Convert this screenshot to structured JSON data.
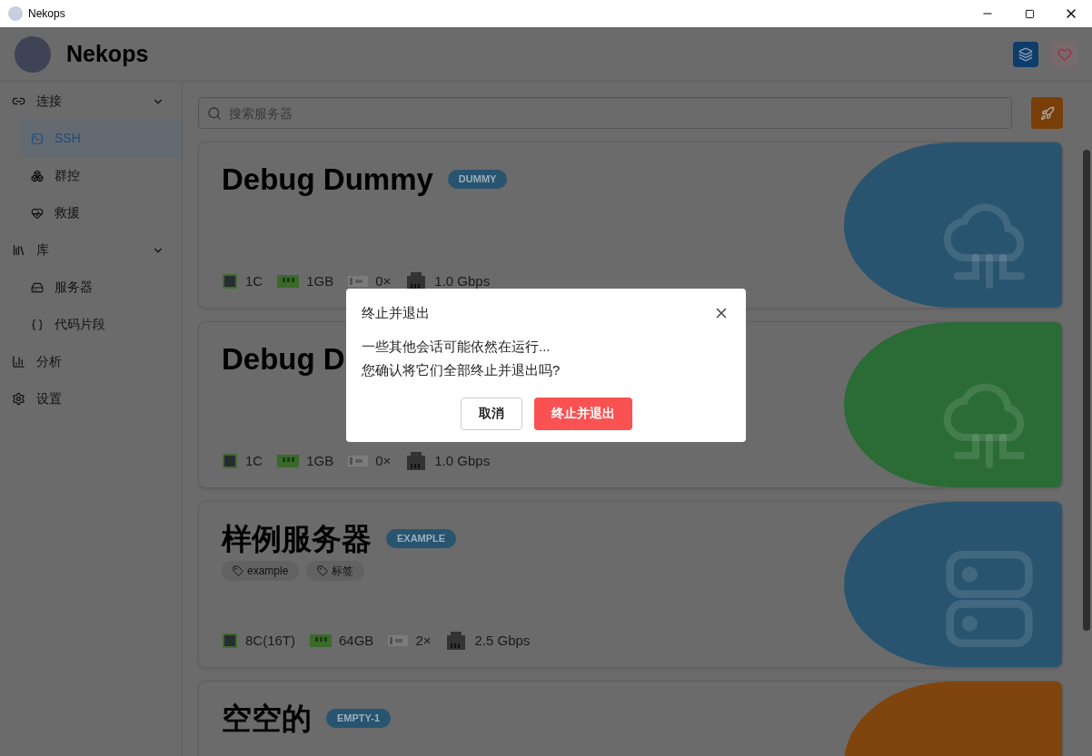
{
  "window": {
    "title": "Nekops"
  },
  "header": {
    "app_name": "Nekops"
  },
  "sidebar": [
    {
      "label": "连接",
      "expanded": true,
      "children": [
        {
          "label": "SSH",
          "selected": true
        },
        {
          "label": "群控",
          "selected": false
        },
        {
          "label": "救援",
          "selected": false
        }
      ]
    },
    {
      "label": "库",
      "expanded": true,
      "children": [
        {
          "label": "服务器",
          "selected": false
        },
        {
          "label": "代码片段",
          "selected": false
        }
      ]
    },
    {
      "label": "分析",
      "selected": false
    },
    {
      "label": "设置",
      "selected": false
    }
  ],
  "search": {
    "placeholder": "搜索服务器"
  },
  "servers": [
    {
      "name": "Debug Dummy",
      "badge": "DUMMY",
      "color": "#28546f",
      "kind": "cloud",
      "cpu": "1C",
      "memory": "1GB",
      "gpu": "0×",
      "network": "1.0 Gbps"
    },
    {
      "name": "Debug D",
      "color": "#2b6b35",
      "kind": "cloud",
      "cpu": "1C",
      "memory": "1GB",
      "gpu": "0×",
      "network": "1.0 Gbps"
    },
    {
      "name": "样例服务器",
      "badge": "EXAMPLE",
      "color": "#28546f",
      "kind": "server",
      "tags": [
        "example",
        "标签"
      ],
      "cpu": "8C(16T)",
      "memory": "64GB",
      "gpu": "2×",
      "network": "2.5 Gbps"
    },
    {
      "name": "空空的",
      "badge": "EMPTY-1",
      "color": "#80450e",
      "kind": "none"
    }
  ],
  "dialog": {
    "title": "终止并退出",
    "lines": [
      "一些其他会话可能依然在运行...",
      "您确认将它们全部终止并退出吗?"
    ],
    "buttons": [
      {
        "label": "取消",
        "kind": "secondary"
      },
      {
        "label": "终止并退出",
        "kind": "danger"
      }
    ]
  }
}
